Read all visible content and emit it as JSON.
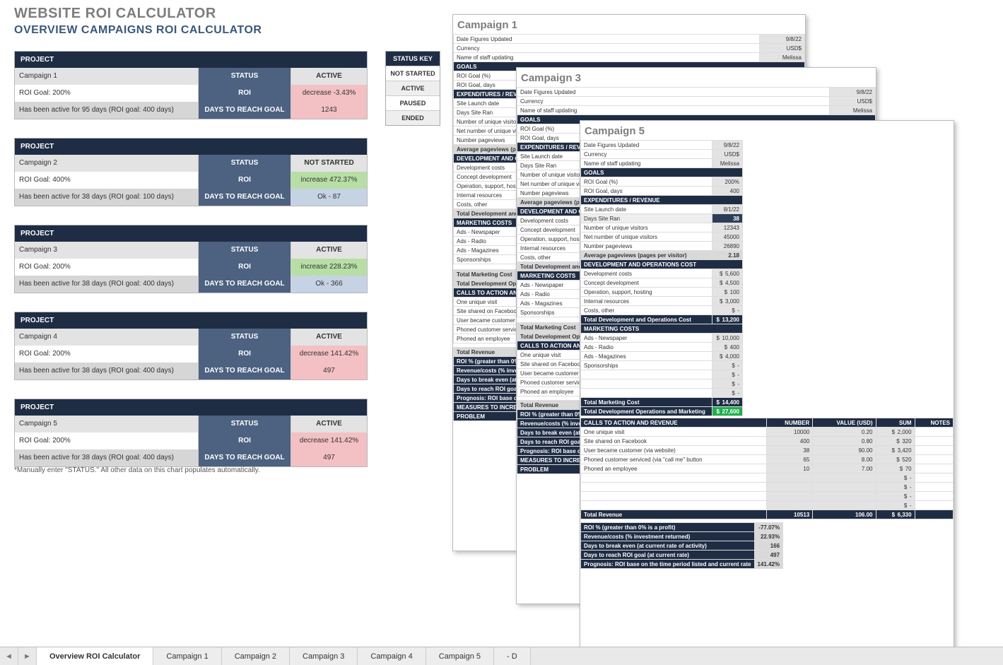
{
  "titles": {
    "main": "WEBSITE ROI CALCULATOR",
    "sub": "OVERVIEW CAMPAIGNS ROI CALCULATOR",
    "footnote": "*Manually enter \"STATUS.\" All other data on this chart populates automatically."
  },
  "labels": {
    "project": "PROJECT",
    "status": "STATUS",
    "roi": "ROI",
    "days_to_reach": "DAYS TO REACH GOAL"
  },
  "status_key": {
    "head": "STATUS KEY",
    "items": [
      "NOT STARTED",
      "ACTIVE",
      "PAUSED",
      "ENDED"
    ]
  },
  "projects": [
    {
      "name": "Campaign 1",
      "status": "ACTIVE",
      "roi_goal": "ROI Goal:  200%",
      "roi_change": "decrease -3.43%",
      "roi_class": "pink",
      "active_text": "Has been active for 95 days (ROI goal: 400 days)",
      "days_value": "1243",
      "days_class": "pink"
    },
    {
      "name": "Campaign 2",
      "status": "NOT STARTED",
      "roi_goal": "ROI Goal:  400%",
      "roi_change": "increase 472.37%",
      "roi_class": "green",
      "active_text": "Has been active for 38 days (ROI goal: 100 days)",
      "days_value": "Ok - 87",
      "days_class": "blue"
    },
    {
      "name": "Campaign 3",
      "status": "ACTIVE",
      "roi_goal": "ROI Goal:  200%",
      "roi_change": "increase 228.23%",
      "roi_class": "green",
      "active_text": "Has been active for 38 days (ROI goal: 400 days)",
      "days_value": "Ok - 366",
      "days_class": "blue"
    },
    {
      "name": "Campaign 4",
      "status": "ACTIVE",
      "roi_goal": "ROI Goal:  200%",
      "roi_change": "decrease 141.42%",
      "roi_class": "pink",
      "active_text": "Has been active for 38 days (ROI goal: 400 days)",
      "days_value": "497",
      "days_class": "pink"
    },
    {
      "name": "Campaign 5",
      "status": "ACTIVE",
      "roi_goal": "ROI Goal:  200%",
      "roi_change": "decrease 141.42%",
      "roi_class": "pink",
      "active_text": "Has been active for 38 days (ROI goal: 400 days)",
      "days_value": "497",
      "days_class": "pink"
    }
  ],
  "tabs": {
    "items": [
      "Overview ROI Calculator",
      "Campaign 1",
      "Campaign 2",
      "Campaign 3",
      "Campaign 4",
      "Campaign 5",
      "- D"
    ],
    "active": 0
  },
  "sheet_sections": {
    "meta": [
      "Date Figures Updated",
      "Currency",
      "Name of staff updating"
    ],
    "goals": {
      "head": "GOALS",
      "rows": [
        "ROI Goal (%)",
        "ROI Goal, days"
      ]
    },
    "exp": {
      "head": "EXPENDITURES / REVENUE",
      "rows": [
        "Site Launch date",
        "Days Site Ran",
        "Number of unique visitors",
        "Net number of unique visitors",
        "Number pageviews",
        "Average pageviews (pages per visitor)"
      ]
    },
    "dev": {
      "head": "DEVELOPMENT AND OPERATIONS COST",
      "rows": [
        "Development costs",
        "Concept development",
        "Operation, support, hosting",
        "Internal resources",
        "Costs, other",
        "Total Development and Operations Cost"
      ]
    },
    "mkt": {
      "head": "MARKETING COSTS",
      "rows": [
        "Ads - Newspaper",
        "Ads - Radio",
        "Ads - Magazines",
        "Sponsorships"
      ],
      "totals": [
        "Total Marketing Cost",
        "Total Development Operations and Marketing"
      ]
    },
    "cta": {
      "head": "CALLS TO ACTION AND REVENUE",
      "cols": [
        "NUMBER",
        "VALUE (USD)",
        "SUM",
        "NOTES"
      ],
      "rows": [
        "One unique visit",
        "Site shared on Facebook",
        "User became customer (via website)",
        "Phoned customer serviced (via \"call me\" button",
        "Phoned an employee"
      ],
      "total": "Total Revenue"
    },
    "metrics": [
      "ROI % (greater than 0% is a profit)",
      "Revenue/costs (% investment returned)",
      "Days to break even (at current rate of activity)",
      "Days to reach ROI goal (at current rate)",
      "Prognosis: ROI base on the time period listed and current rate"
    ],
    "measures": {
      "head": "MEASURES TO INCREASE ROI",
      "sub": "PROBLEM"
    }
  },
  "campaign5": {
    "title": "Campaign 5",
    "meta_vals": [
      "9/8/22",
      "USD$",
      "Melissa"
    ],
    "goals_vals": [
      "200%",
      "400"
    ],
    "exp_vals": [
      "8/1/22",
      "38",
      "12343",
      "45000",
      "26890",
      "2.18"
    ],
    "dev_vals": [
      "5,600",
      "4,500",
      "100",
      "3,000",
      "-",
      "13,200"
    ],
    "mkt_vals": [
      "10,000",
      "400",
      "4,000",
      "-",
      "-",
      "-",
      "-"
    ],
    "mkt_total": "14,400",
    "grand_total": "27,600",
    "cta_rows": [
      {
        "n": "10000",
        "v": "0.20",
        "s": "2,000"
      },
      {
        "n": "400",
        "v": "0.80",
        "s": "320"
      },
      {
        "n": "38",
        "v": "90.00",
        "s": "3,420"
      },
      {
        "n": "65",
        "v": "8.00",
        "s": "520"
      },
      {
        "n": "10",
        "v": "7.00",
        "s": "70"
      }
    ],
    "cta_blanks": [
      "-",
      "-",
      "-",
      "-"
    ],
    "cta_total": {
      "n": "10513",
      "v": "106.00",
      "s": "6,330"
    },
    "metrics_vals": [
      "-77.07%",
      "22.93%",
      "166",
      "497",
      "141.42%"
    ]
  },
  "campaign1": {
    "title": "Campaign 1",
    "meta_vals": [
      "9/8/22",
      "USD$",
      "Melissa"
    ]
  },
  "campaign3": {
    "title": "Campaign 3",
    "meta_vals": [
      "9/8/22",
      "USD$",
      "Melissa"
    ]
  }
}
